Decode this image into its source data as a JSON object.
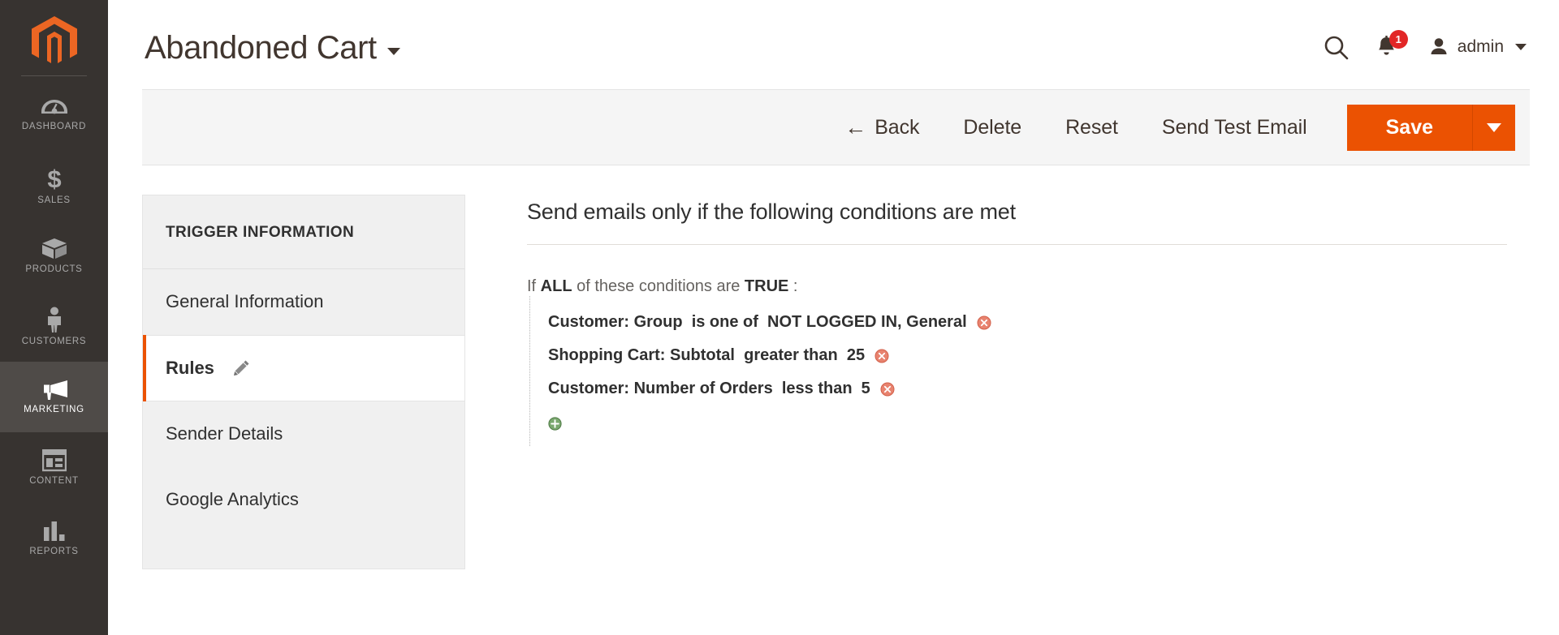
{
  "sidebar": {
    "logo": "magento-logo",
    "items": [
      {
        "label": "Dashboard",
        "icon": "dashboard-icon",
        "active": false
      },
      {
        "label": "Sales",
        "icon": "dollar-icon",
        "active": false
      },
      {
        "label": "Products",
        "icon": "box-icon",
        "active": false
      },
      {
        "label": "Customers",
        "icon": "person-icon",
        "active": false
      },
      {
        "label": "Marketing",
        "icon": "megaphone-icon",
        "active": true
      },
      {
        "label": "Content",
        "icon": "layout-icon",
        "active": false
      },
      {
        "label": "Reports",
        "icon": "bar-chart-icon",
        "active": false
      }
    ]
  },
  "header": {
    "title": "Abandoned Cart",
    "search_icon": "search-icon",
    "notifications_icon": "bell-icon",
    "notifications_count": "1",
    "user_icon": "user-avatar-icon",
    "user_name": "admin"
  },
  "toolbar": {
    "back_label": "Back",
    "back_arrow": "←",
    "delete_label": "Delete",
    "reset_label": "Reset",
    "send_test_email_label": "Send Test Email",
    "save_label": "Save",
    "save_caret_icon": "chevron-down-icon"
  },
  "side_panel": {
    "title": "Trigger Information",
    "items": [
      {
        "label": "General Information",
        "active": false,
        "has_edit_icon": false
      },
      {
        "label": "Rules",
        "active": true,
        "has_edit_icon": true,
        "edit_icon": "pencil-icon"
      },
      {
        "label": "Sender Details",
        "active": false,
        "has_edit_icon": false
      },
      {
        "label": "Google Analytics",
        "active": false,
        "has_edit_icon": false
      }
    ]
  },
  "rules": {
    "heading": "Send emails only if the following conditions are met",
    "if_prefix": "If ",
    "aggregator": "ALL",
    "if_middle": " of these conditions are ",
    "truth_value": "TRUE",
    "if_suffix": " :",
    "conditions": [
      {
        "attribute": "Customer: Group",
        "operator": "is one of",
        "value": "NOT LOGGED IN, General",
        "delete_icon": "delete-circle-icon"
      },
      {
        "attribute": "Shopping Cart: Subtotal",
        "operator": "greater than",
        "value": "25",
        "delete_icon": "delete-circle-icon"
      },
      {
        "attribute": "Customer: Number of Orders",
        "operator": "less than",
        "value": "5",
        "delete_icon": "delete-circle-icon"
      }
    ],
    "add_icon": "add-circle-icon"
  },
  "colors": {
    "brand_orange": "#eb5202",
    "sidebar_bg": "#373330",
    "sidebar_active_bg": "#4f4b48",
    "badge_red": "#e22626",
    "delete_icon_red": "#e8836f",
    "add_icon_green": "#5a9a53"
  }
}
